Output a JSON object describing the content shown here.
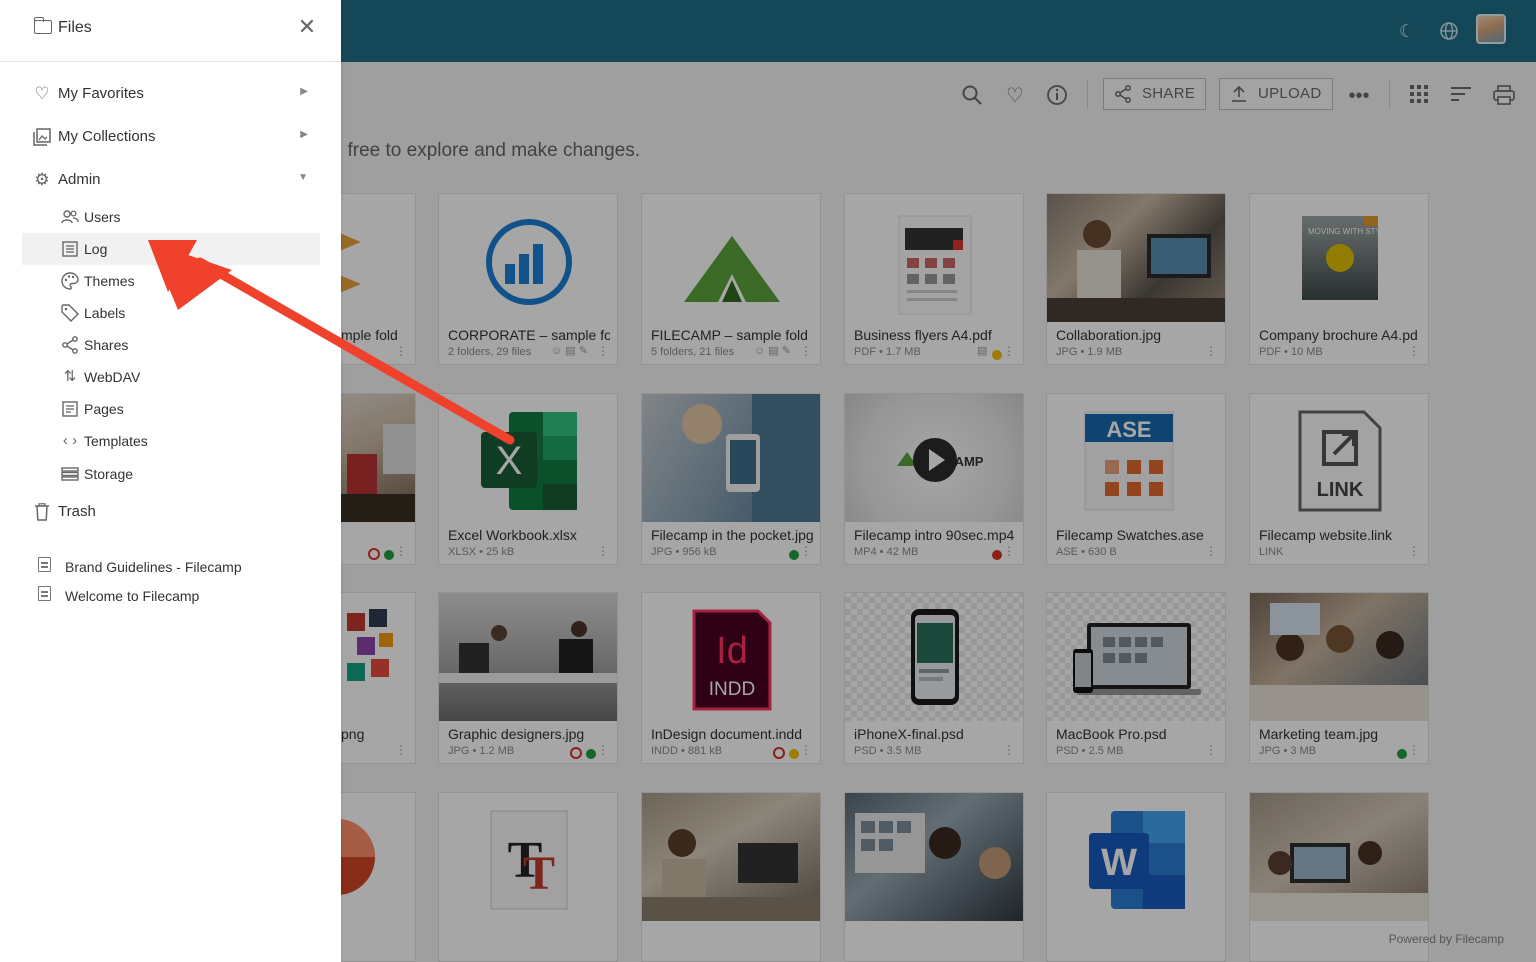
{
  "sidebar": {
    "title": "Files",
    "items": [
      {
        "label": "My Favorites"
      },
      {
        "label": "My Collections"
      },
      {
        "label": "Admin"
      }
    ],
    "admin_items": [
      {
        "label": "Users"
      },
      {
        "label": "Log"
      },
      {
        "label": "Themes"
      },
      {
        "label": "Labels"
      },
      {
        "label": "Shares"
      },
      {
        "label": "WebDAV"
      },
      {
        "label": "Pages"
      },
      {
        "label": "Templates"
      },
      {
        "label": "Storage"
      }
    ],
    "trash": "Trash",
    "pages": [
      {
        "label": "Brand Guidelines - Filecamp"
      },
      {
        "label": "Welcome to Filecamp"
      }
    ]
  },
  "toolbar": {
    "share_label": "SHARE",
    "upload_label": "UPLOAD"
  },
  "intro_text": "l free to explore and make changes.",
  "cards": [
    {
      "name": "mple fold",
      "meta": ""
    },
    {
      "name": "CORPORATE – sample fo",
      "meta": "2 folders, 29 files"
    },
    {
      "name": "FILECAMP – sample fold",
      "meta": "5 folders, 21 files"
    },
    {
      "name": "Business flyers A4.pdf",
      "meta": "PDF • 1.7 MB"
    },
    {
      "name": "Collaboration.jpg",
      "meta": "JPG • 1.9 MB"
    },
    {
      "name": "Company brochure A4.pd",
      "meta": "PDF • 10 MB"
    },
    {
      "name": "",
      "meta": ""
    },
    {
      "name": "Excel Workbook.xlsx",
      "meta": "XLSX • 25 kB"
    },
    {
      "name": "Filecamp in the pocket.jpg",
      "meta": "JPG • 956 kB"
    },
    {
      "name": "Filecamp intro 90sec.mp4",
      "meta": "MP4 • 42 MB"
    },
    {
      "name": "Filecamp Swatches.ase",
      "meta": "ASE • 630 B"
    },
    {
      "name": "Filecamp website.link",
      "meta": "LINK"
    },
    {
      "name": "png",
      "meta": ""
    },
    {
      "name": "Graphic designers.jpg",
      "meta": "JPG • 1.2 MB"
    },
    {
      "name": "InDesign document.indd",
      "meta": "INDD • 881 kB"
    },
    {
      "name": "iPhoneX-final.psd",
      "meta": "PSD • 3.5 MB"
    },
    {
      "name": "MacBook Pro.psd",
      "meta": "PSD • 2.5 MB"
    },
    {
      "name": "Marketing team.jpg",
      "meta": "JPG • 3 MB"
    }
  ],
  "thumb_text": {
    "ase": "ASE",
    "link": "LINK",
    "indd_top": "Id",
    "indd_bottom": "INDD",
    "excel": "X",
    "word": "W",
    "video_logo": "FILECAMP",
    "brochure": "MOVING WITH STYLE"
  },
  "powered_by": "Powered by Filecamp",
  "colors": {
    "topbar": "#1f6f88",
    "arrow": "#f0412c",
    "status_green": "#1e9e3e",
    "status_red": "#d93025",
    "status_yellow": "#f2c200"
  },
  "icons": {
    "moon": "moon-icon",
    "globe": "globe-icon",
    "search": "search-icon",
    "heart": "heart-icon",
    "info": "info-icon",
    "share": "share-icon",
    "upload": "upload-icon",
    "more": "more-icon",
    "grid": "grid-icon",
    "sort": "sort-icon",
    "print": "print-icon"
  }
}
